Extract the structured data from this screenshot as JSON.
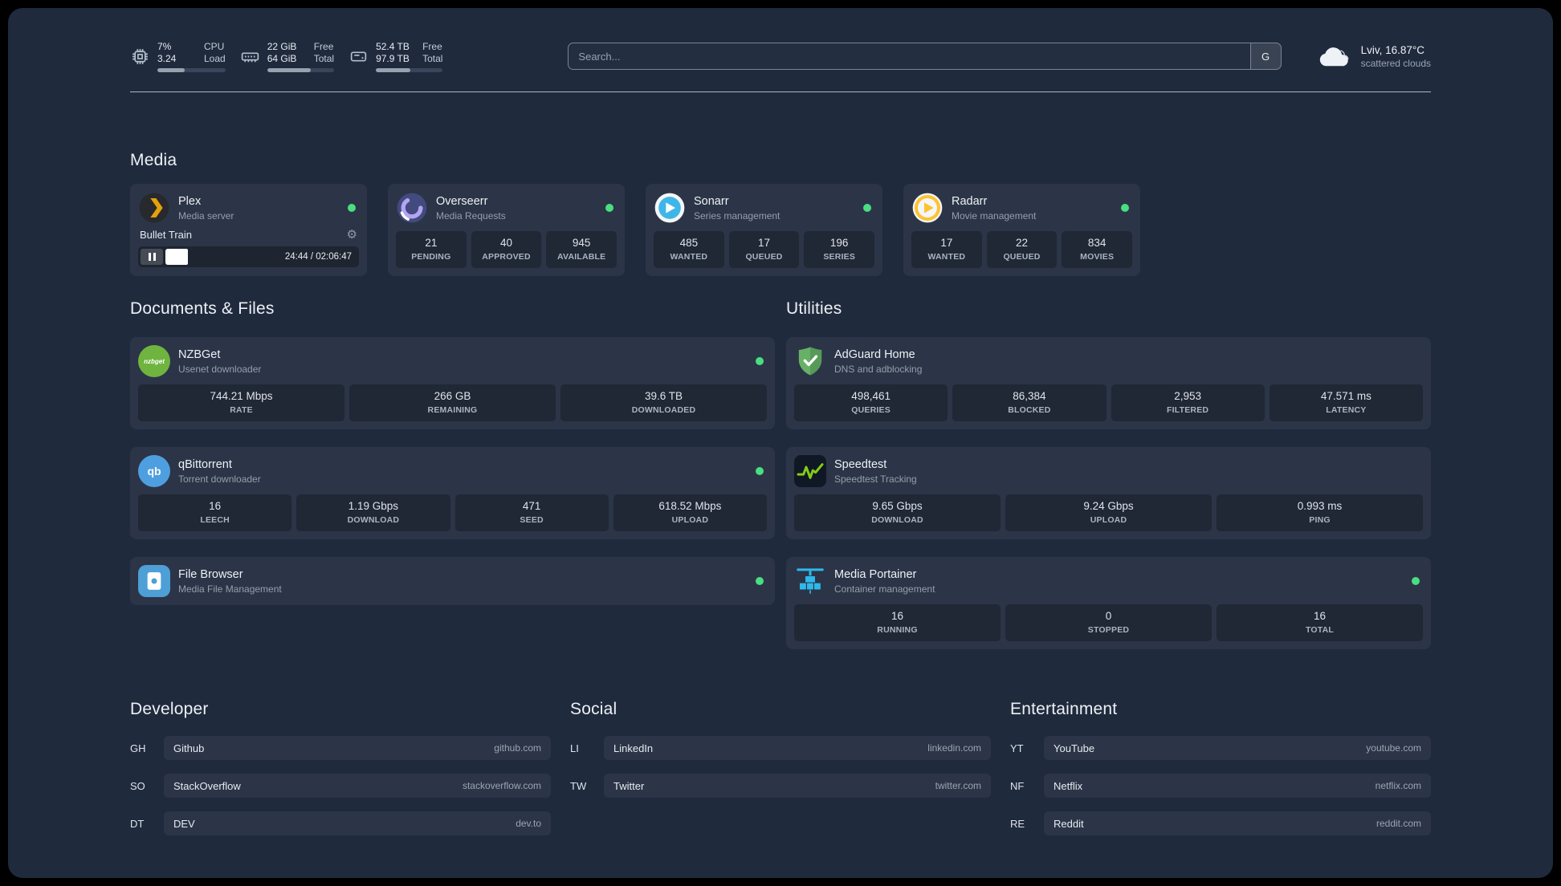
{
  "colors": {
    "page_background": "#1f2a3d",
    "card_background": "rgba(255,255,255,0.055)",
    "stat_background": "rgba(0,0,0,0.25)",
    "status_online": "#4ade80",
    "text_primary": "#eef1f5",
    "text_secondary": "#949eac",
    "plex_gold": "#e5a00d",
    "sonarr_blue": "#3fb6e8",
    "radarr_amber": "#ffc230",
    "overseerr_purple": "#b3a5f2",
    "nzbget_green": "#6fb43f",
    "qbittorrent_blue": "#4e9fe0",
    "filebrowser_blue": "#4d9fd6",
    "adguard_green": "#67b167",
    "speedtest_green": "#84cc16",
    "portainer_blue": "#2fb8ec"
  },
  "icons": {
    "gear_glyph": "⚙",
    "cpu": "cpu-chip-outline",
    "memory": "ram-stick-outline",
    "disk": "hard-drive-outline",
    "weather": "cloud",
    "pause": "pause-bars",
    "status": "green-dot"
  },
  "topbar": {
    "cpu": {
      "value_top": "7%",
      "value_bottom": "3.24",
      "label_top": "CPU",
      "label_bottom": "Load",
      "bar_percent": 40
    },
    "memory": {
      "value_top": "22 GiB",
      "value_bottom": "64 GiB",
      "label_top": "Free",
      "label_bottom": "Total",
      "bar_percent": 65
    },
    "disk": {
      "value_top": "52.4 TB",
      "value_bottom": "97.9 TB",
      "label_top": "Free",
      "label_bottom": "Total",
      "bar_percent": 52
    },
    "search": {
      "placeholder": "Search...",
      "button_label": "G"
    },
    "weather": {
      "location": "Lviv, 16.87°C",
      "condition": "scattered clouds"
    }
  },
  "sections": {
    "media": {
      "title": "Media",
      "plex": {
        "name": "Plex",
        "description": "Media server",
        "online": true,
        "now_playing": {
          "title": "Bullet Train",
          "time_display": "24:44 / 02:06:47",
          "progress_percent": 19.5
        }
      },
      "overseerr": {
        "name": "Overseerr",
        "description": "Media Requests",
        "online": true,
        "stats": [
          {
            "value": "21",
            "label": "PENDING"
          },
          {
            "value": "40",
            "label": "APPROVED"
          },
          {
            "value": "945",
            "label": "AVAILABLE"
          }
        ]
      },
      "sonarr": {
        "name": "Sonarr",
        "description": "Series management",
        "online": true,
        "stats": [
          {
            "value": "485",
            "label": "WANTED"
          },
          {
            "value": "17",
            "label": "QUEUED"
          },
          {
            "value": "196",
            "label": "SERIES"
          }
        ]
      },
      "radarr": {
        "name": "Radarr",
        "description": "Movie management",
        "online": true,
        "stats": [
          {
            "value": "17",
            "label": "WANTED"
          },
          {
            "value": "22",
            "label": "QUEUED"
          },
          {
            "value": "834",
            "label": "MOVIES"
          }
        ]
      }
    },
    "documents": {
      "title": "Documents & Files",
      "nzbget": {
        "name": "NZBGet",
        "description": "Usenet downloader",
        "online": true,
        "logo_text": "nzbget",
        "stats": [
          {
            "value": "744.21 Mbps",
            "label": "RATE"
          },
          {
            "value": "266 GB",
            "label": "REMAINING"
          },
          {
            "value": "39.6 TB",
            "label": "DOWNLOADED"
          }
        ]
      },
      "qbittorrent": {
        "name": "qBittorrent",
        "description": "Torrent downloader",
        "online": true,
        "logo_text": "qb",
        "stats": [
          {
            "value": "16",
            "label": "LEECH"
          },
          {
            "value": "1.19 Gbps",
            "label": "DOWNLOAD"
          },
          {
            "value": "471",
            "label": "SEED"
          },
          {
            "value": "618.52 Mbps",
            "label": "UPLOAD"
          }
        ]
      },
      "filebrowser": {
        "name": "File Browser",
        "description": "Media File Management",
        "online": true
      }
    },
    "utilities": {
      "title": "Utilities",
      "adguard": {
        "name": "AdGuard Home",
        "description": "DNS and adblocking",
        "stats": [
          {
            "value": "498,461",
            "label": "QUERIES"
          },
          {
            "value": "86,384",
            "label": "BLOCKED"
          },
          {
            "value": "2,953",
            "label": "FILTERED"
          },
          {
            "value": "47.571 ms",
            "label": "LATENCY"
          }
        ]
      },
      "speedtest": {
        "name": "Speedtest",
        "description": "Speedtest Tracking",
        "stats": [
          {
            "value": "9.65 Gbps",
            "label": "DOWNLOAD"
          },
          {
            "value": "9.24 Gbps",
            "label": "UPLOAD"
          },
          {
            "value": "0.993 ms",
            "label": "PING"
          }
        ]
      },
      "portainer": {
        "name": "Media Portainer",
        "description": "Container management",
        "online": true,
        "stats": [
          {
            "value": "16",
            "label": "RUNNING"
          },
          {
            "value": "0",
            "label": "STOPPED"
          },
          {
            "value": "16",
            "label": "TOTAL"
          }
        ]
      }
    },
    "bookmarks": {
      "developer": {
        "title": "Developer",
        "links": [
          {
            "abbr": "GH",
            "name": "Github",
            "url": "github.com"
          },
          {
            "abbr": "SO",
            "name": "StackOverflow",
            "url": "stackoverflow.com"
          },
          {
            "abbr": "DT",
            "name": "DEV",
            "url": "dev.to"
          }
        ]
      },
      "social": {
        "title": "Social",
        "links": [
          {
            "abbr": "LI",
            "name": "LinkedIn",
            "url": "linkedin.com"
          },
          {
            "abbr": "TW",
            "name": "Twitter",
            "url": "twitter.com"
          }
        ]
      },
      "entertainment": {
        "title": "Entertainment",
        "links": [
          {
            "abbr": "YT",
            "name": "YouTube",
            "url": "youtube.com"
          },
          {
            "abbr": "NF",
            "name": "Netflix",
            "url": "netflix.com"
          },
          {
            "abbr": "RE",
            "name": "Reddit",
            "url": "reddit.com"
          }
        ]
      }
    }
  }
}
